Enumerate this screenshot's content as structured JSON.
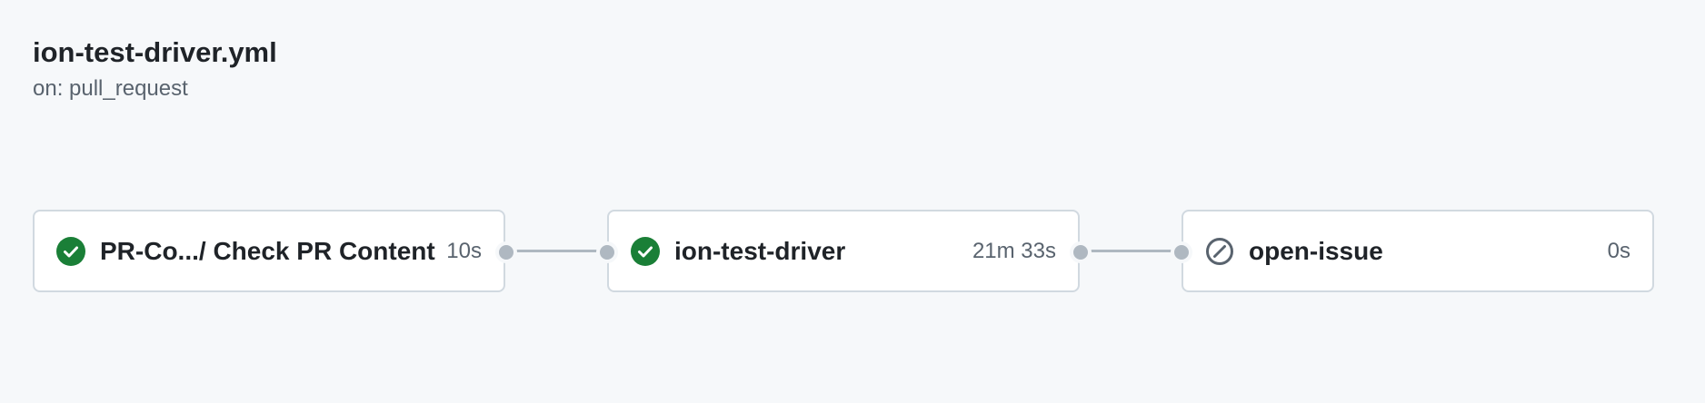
{
  "workflow": {
    "title": "ion-test-driver.yml",
    "trigger": "on: pull_request"
  },
  "jobs": [
    {
      "name": "PR-Co.../ Check PR Content",
      "duration": "10s",
      "status": "success",
      "status_icon": "check-circle-fill-icon",
      "status_color": "#1a7f37"
    },
    {
      "name": "ion-test-driver",
      "duration": "21m 33s",
      "status": "success",
      "status_icon": "check-circle-fill-icon",
      "status_color": "#1a7f37"
    },
    {
      "name": "open-issue",
      "duration": "0s",
      "status": "skipped",
      "status_icon": "skip-icon",
      "status_color": "#59636e"
    }
  ],
  "colors": {
    "background": "#f6f8fa",
    "card_border": "#d1d9e0",
    "connector": "#afb8c1",
    "success": "#1a7f37",
    "muted": "#59636e"
  }
}
